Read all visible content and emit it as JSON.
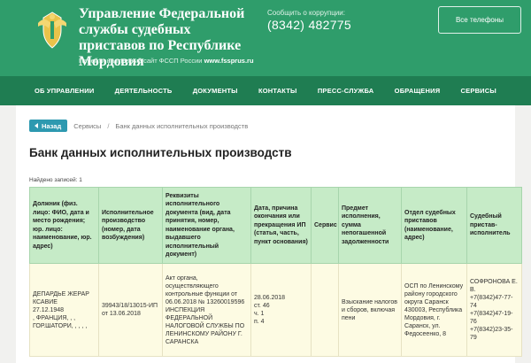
{
  "header": {
    "title": "Управление Федеральной службы судебных приставов по Республике Мордовия",
    "main_site_link_prefix": "Перейти на главный сайт ФССП России",
    "main_site_link_domain": "www.fssprus.ru",
    "corruption_label": "Сообщить о коррупции:",
    "corruption_phone": "(8342) 482775",
    "phones_button": "Все телефоны",
    "emblem_icon": "fssp-emblem-icon",
    "brand_color": "#2f9d6b"
  },
  "nav": {
    "items": [
      "ОБ УПРАВЛЕНИИ",
      "ДЕЯТЕЛЬНОСТЬ",
      "ДОКУМЕНТЫ",
      "КОНТАКТЫ",
      "ПРЕСС-СЛУЖБА",
      "ОБРАЩЕНИЯ",
      "СЕРВИСЫ"
    ]
  },
  "breadcrumb": {
    "back_label": "Назад",
    "items": [
      "Сервисы",
      "Банк данных исполнительных производств"
    ]
  },
  "page": {
    "title": "Банк данных исполнительных производств",
    "found": "Найдено записей: 1"
  },
  "table": {
    "headers": [
      "Должник (физ. лицо: ФИО, дата и место рождения; юр. лицо: наименование, юр. адрес)",
      "Исполнительное производство (номер, дата возбуждения)",
      "Реквизиты исполнительного документа (вид, дата принятия, номер, наименование органа, выдавшего исполнительный документ)",
      "Дата, причина окончания или прекращения ИП (статья, часть, пункт основания)",
      "Сервис",
      "Предмет исполнения, сумма непогашенной задолженности",
      "Отдел судебных приставов (наименование, адрес)",
      "Судебный пристав-исполнитель"
    ],
    "rows": [
      [
        "ДЕПАРДЬЕ ЖЕРАР КСАВИЕ\n27.12.1948\n, ФРАНЦИЯ, , ,\nГОР.ШАТОРИ, , , , ,",
        "39943/18/13015-ИП от 13.06.2018",
        "Акт органа, осуществляющего контрольные функции от 06.06.2018 № 13260019596 ИНСПЕКЦИЯ ФЕДЕРАЛЬНОЙ НАЛОГОВОЙ СЛУЖБЫ ПО ЛЕНИНСКОМУ РАЙОНУ Г. САРАНСКА",
        "28.06.2018\nст. 46\nч. 1\nп. 4",
        "",
        "Взыскание налогов и сборов, включая пени",
        "ОСП по Ленинскому району городского округа Саранск 430003, Республика Мордовия, г. Саранск, ул. Федосеенко, 8",
        "СОФРОНОВА Е. В.\n+7(8342)47-77-74\n+7(8342)47-19-76\n+7(8342)23-35-79"
      ]
    ]
  }
}
